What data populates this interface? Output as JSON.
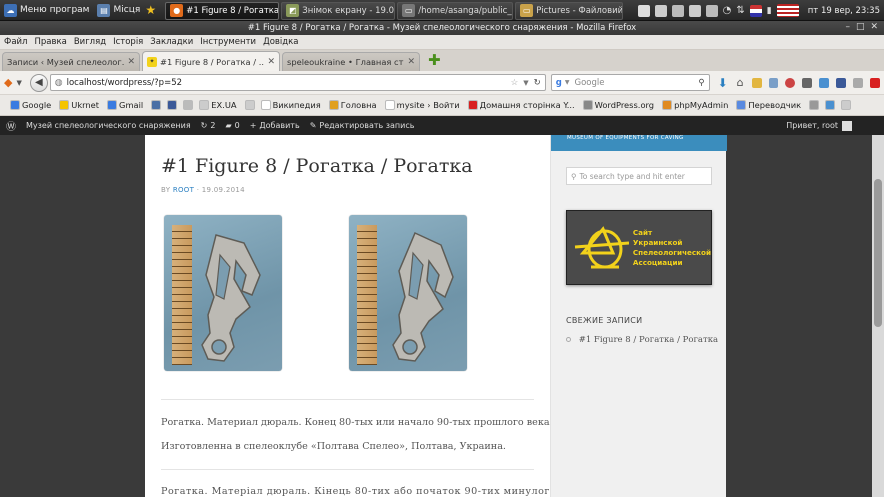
{
  "panel": {
    "menu_label": "Меню програм",
    "places_label": "Місця",
    "tasks": [
      {
        "label": "#1 Figure 8 / Рогатка / ..."
      },
      {
        "label": "Знімок екрану - 19.09...."
      },
      {
        "label": "/home/asanga/public_h..."
      },
      {
        "label": "Pictures - Файловий м..."
      }
    ],
    "clock": "пт 19 вер, 23:35"
  },
  "window": {
    "title": "#1 Figure 8 / Рогатка / Рогатка - Музей спелеологического снаряжения - Mozilla Firefox"
  },
  "menubar": [
    "Файл",
    "Правка",
    "Вигляд",
    "Історія",
    "Закладки",
    "Інструменти",
    "Довідка"
  ],
  "tabs": [
    {
      "label": "Записи ‹ Музей спелеолог..."
    },
    {
      "label": "#1 Figure 8 / Рогатка / ..."
    },
    {
      "label": "speleoukraine • Главная ст..."
    }
  ],
  "navbar": {
    "url": "localhost/wordpress/?p=52",
    "search_placeholder": "Google"
  },
  "bookmarks": [
    {
      "label": "Google",
      "icon": "google-icon",
      "color": "#3a7be0"
    },
    {
      "label": "Ukrnet",
      "icon": "ukrnet-icon",
      "color": "#f5c400"
    },
    {
      "label": "Gmail",
      "icon": "gmail-icon",
      "color": "#3a7be0"
    },
    {
      "label": "",
      "icon": "vkontakte-icon",
      "color": "#4a6fa5"
    },
    {
      "label": "",
      "icon": "facebook-icon",
      "color": "#3b5998"
    },
    {
      "label": "",
      "icon": "page-icon",
      "color": "#bbbbbb"
    },
    {
      "label": "EX.UA",
      "icon": "exua-icon",
      "color": "#cccccc"
    },
    {
      "label": "",
      "icon": "mail-icon",
      "color": "#cccccc"
    },
    {
      "label": "Википедия",
      "icon": "wikipedia-icon",
      "color": "#ffffff"
    },
    {
      "label": "Головна",
      "icon": "lightning-icon",
      "color": "#e0a020"
    },
    {
      "label": "mysite › Войти",
      "icon": "page-icon",
      "color": "#ffffff"
    },
    {
      "label": "Домашня сторінка Y...",
      "icon": "youtube-icon",
      "color": "#d82020"
    },
    {
      "label": "WordPress.org",
      "icon": "wordpress-icon",
      "color": "#888888"
    },
    {
      "label": "phpMyAdmin",
      "icon": "phpmyadmin-icon",
      "color": "#e08a20"
    },
    {
      "label": "Переводчик",
      "icon": "translator-icon",
      "color": "#5a8ae0"
    },
    {
      "label": "",
      "icon": "gear-icon",
      "color": "#999999"
    },
    {
      "label": "",
      "icon": "drop-icon",
      "color": "#4a90d0"
    },
    {
      "label": "",
      "icon": "page-icon",
      "color": "#cccccc"
    }
  ],
  "adminbar": {
    "site_name": "Музей спелеологического снаряжения",
    "updates_count": "2",
    "comments_count": "0",
    "add_label": "Добавить",
    "edit_label": "Редактировать запись",
    "greeting": "Привет, root"
  },
  "post": {
    "title": "#1 Figure 8 / Рогатка / Рогатка",
    "by": "BY",
    "author": "ROOT",
    "date": "· 19.09.2014",
    "paragraphs": [
      "Рогатка. Материал дюраль. Конец 80-тых или начало 90-тых прошлого века.",
      "Изготовленна в спелеоклубе «Полтава Спелео», Полтава, Украина.",
      "Рогатка. Матеріал дюраль. Кінець 80-тих або початок 90-тих минулого"
    ]
  },
  "sidebar": {
    "header_text": "MUSEUM OF EQUIPMENTS FOR CAVING",
    "search_placeholder": "To search type and hit enter",
    "logo_text": [
      "Сайт",
      "Украинской",
      "Спелеологической",
      "Ассоциации"
    ],
    "recent_title": "СВЕЖИЕ ЗАПИСИ",
    "recent_posts": [
      "#1 Figure 8 / Рогатка / Рогатка"
    ]
  },
  "colors": {
    "accent": "#3b8dbd",
    "admin_bar": "#232323",
    "logo_text": "#f2d21b"
  }
}
